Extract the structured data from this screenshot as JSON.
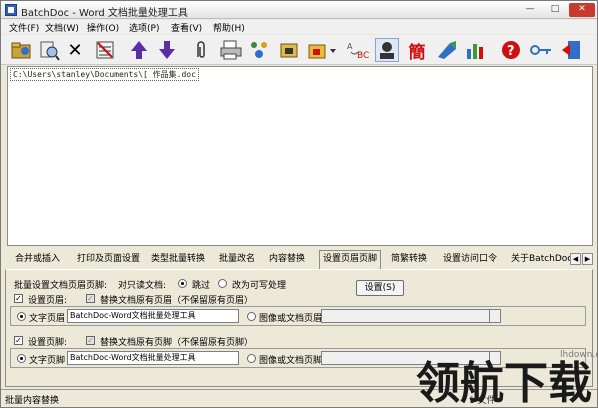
{
  "window": {
    "title": "BatchDoc - Word 文档批量处理工具"
  },
  "titlebar_buttons": {
    "minimize": "—",
    "maximize": "□",
    "close": "✕"
  },
  "menu": [
    "文件(F)",
    "文档(W)",
    "操作(O)",
    "选项(P)",
    "查看(V)",
    "帮助(H)"
  ],
  "toolbar": {
    "icons": [
      "open-folder-icon",
      "find-files-icon",
      "delete-icon",
      "clear-list-icon",
      "move-up-icon",
      "move-down-icon",
      "attachment-icon",
      "print-icon",
      "batch-run-icon",
      "dispatch-icon",
      "folder-options-icon",
      "abc-replace-icon",
      "account-icon",
      "traditional-simplified-icon",
      "convert-icon",
      "stats-icon",
      "help-icon",
      "key-icon",
      "exit-icon"
    ],
    "traditional_char": "簡",
    "abc_label": "ABC",
    "colors": {
      "arrow": "#5a2ea6",
      "help": "#d01010",
      "simplified": "#d01010"
    }
  },
  "file_list": {
    "rows": [
      "C:\\Users\\stanley\\Documents\\[ 作品集.doc"
    ]
  },
  "tabs": [
    "合并或插入",
    "打印及页面设置",
    "类型批量转换",
    "批量改名",
    "内容替换",
    "设置页眉页脚",
    "简繁转换",
    "设置访问口令",
    "关于BatchDoc"
  ],
  "active_tab": "设置页眉页脚",
  "tab_scroll": {
    "left": "◀",
    "right": "▶"
  },
  "panel": {
    "title": "批量设置文档页眉页脚:",
    "readonly_label": "对只读文档:",
    "skip_label": "跳过",
    "writable_label": "改为可写处理",
    "settings_button": "设置(S)",
    "header": {
      "checkbox_label": "设置页眉:",
      "replace_label": "替换文档原有页眉（不保留原有页眉）",
      "text_radio": "文字页眉",
      "text_value": "BatchDoc-Word文档批量处理工具",
      "image_radio": "图像或文档页眉",
      "image_value": ""
    },
    "footer": {
      "checkbox_label": "设置页脚:",
      "replace_label": "替换文档原有页脚（不保留原有页脚）",
      "text_radio": "文字页脚",
      "text_value": "BatchDoc-Word文档批量处理工具",
      "image_radio": "图像或文档页脚",
      "image_value": ""
    },
    "check_mark": "✓"
  },
  "status": {
    "left": "批量内容替换",
    "right": "1 文件"
  },
  "watermark": {
    "text": "领航下载",
    "url": "lhdown.com"
  }
}
